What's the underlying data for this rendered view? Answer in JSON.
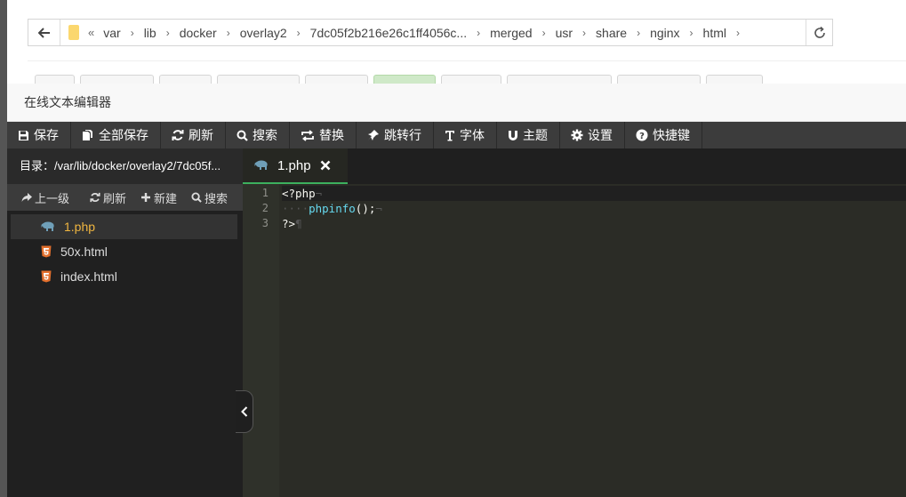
{
  "path": {
    "segments": [
      "var",
      "lib",
      "docker",
      "overlay2",
      "7dc05f2b216e26c1ff4056c...",
      "merged",
      "usr",
      "share",
      "nginx",
      "html"
    ]
  },
  "modal": {
    "title": "在线文本编辑器"
  },
  "toolbar": {
    "items": [
      {
        "label": "保存",
        "icon": "save-icon"
      },
      {
        "label": "全部保存",
        "icon": "save-all-icon"
      },
      {
        "label": "刷新",
        "icon": "refresh-icon"
      },
      {
        "label": "搜索",
        "icon": "search-icon"
      },
      {
        "label": "替换",
        "icon": "replace-icon"
      },
      {
        "label": "跳转行",
        "icon": "pin-icon"
      },
      {
        "label": "字体",
        "icon": "font-icon"
      },
      {
        "label": "主题",
        "icon": "magnet-icon"
      },
      {
        "label": "设置",
        "icon": "gear-icon"
      },
      {
        "label": "快捷键",
        "icon": "help-icon"
      }
    ]
  },
  "sidebar": {
    "directory": "目录：/var/lib/docker/overlay2/7dc05f...",
    "tools": [
      {
        "label": "上一级",
        "icon": "share-up-icon"
      },
      {
        "label": "刷新",
        "icon": "refresh-icon"
      },
      {
        "label": "新建",
        "icon": "plus-icon"
      },
      {
        "label": "搜索",
        "icon": "search-icon"
      }
    ],
    "files": [
      {
        "name": "1.php",
        "type": "php",
        "active": true
      },
      {
        "name": "50x.html",
        "type": "html",
        "active": false
      },
      {
        "name": "index.html",
        "type": "html",
        "active": false
      }
    ]
  },
  "editor": {
    "tab": {
      "label": "1.php"
    },
    "line_numbers": [
      "1",
      "2",
      "3"
    ],
    "lines": {
      "l1": "<?php",
      "l2_fn": "phpinfo",
      "l2_rest": "();",
      "l3": "?>"
    }
  },
  "colors": {
    "accent_tab": "#3cb05e",
    "active_file": "#f0b640",
    "toolbar_bg": "#3c3c3c",
    "editor_bg": "#2b2c26"
  }
}
